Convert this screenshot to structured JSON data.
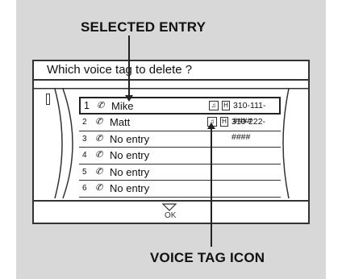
{
  "callouts": {
    "top": "SELECTED ENTRY",
    "bottom": "VOICE TAG ICON"
  },
  "screen": {
    "prompt": "Which voice tag to delete ?",
    "ok_label": "OK",
    "rows": [
      {
        "index": "1",
        "name": "Mike",
        "has_voice_tag": true,
        "phone": "310-111-####",
        "selected": true
      },
      {
        "index": "2",
        "name": "Matt",
        "has_voice_tag": true,
        "phone": "310-222-####",
        "selected": false
      },
      {
        "index": "3",
        "name": "No entry",
        "has_voice_tag": false,
        "phone": "",
        "selected": false
      },
      {
        "index": "4",
        "name": "No entry",
        "has_voice_tag": false,
        "phone": "",
        "selected": false
      },
      {
        "index": "5",
        "name": "No entry",
        "has_voice_tag": false,
        "phone": "",
        "selected": false
      },
      {
        "index": "6",
        "name": "No entry",
        "has_voice_tag": false,
        "phone": "",
        "selected": false
      }
    ]
  },
  "colors": {
    "panel": "#d8d8d8",
    "screen": "#ffffff",
    "ink": "#222222"
  }
}
